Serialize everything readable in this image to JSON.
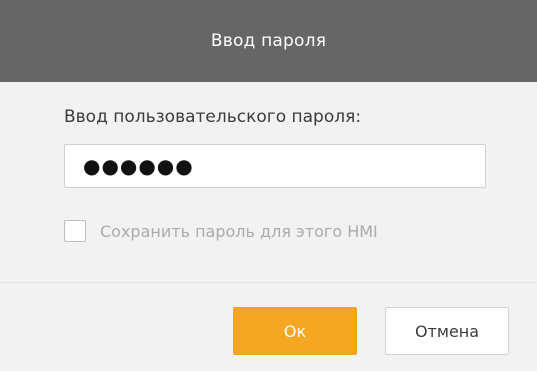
{
  "dialog": {
    "title": "Ввод пароля",
    "prompt_label": "Ввод пользовательского пароля:",
    "password_value": "●●●●●●",
    "remember_label": "Сохранить пароль для этого HMI",
    "remember_checked": false
  },
  "buttons": {
    "ok_label": "Ок",
    "cancel_label": "Отмена"
  },
  "colors": {
    "titlebar": "#666666",
    "ok_button": "#f5a623",
    "background": "#f2f2f2"
  }
}
